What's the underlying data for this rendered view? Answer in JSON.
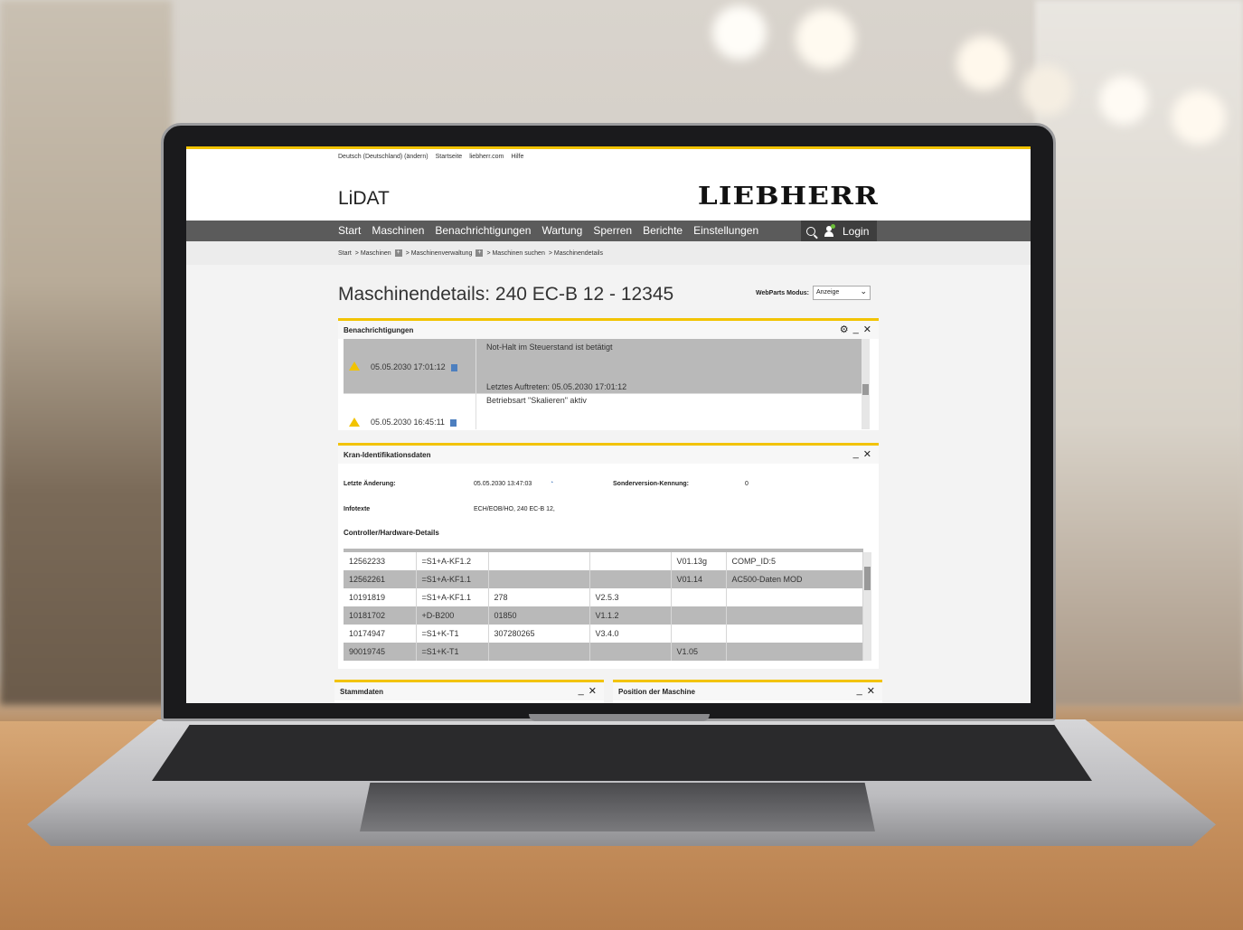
{
  "toplinks": [
    "Deutsch (Deutschland) (ändern)",
    "Startseite",
    "liebherr.com",
    "Hilfe"
  ],
  "app_title": "LiDAT",
  "logo_text": "LIEBHERR",
  "nav": [
    "Start",
    "Maschinen",
    "Benachrichtigungen",
    "Wartung",
    "Sperren",
    "Berichte",
    "Einstellungen"
  ],
  "login_label": "Login",
  "breadcrumb": [
    "Start",
    "> Maschinen",
    "> Maschinenverwaltung",
    "> Maschinen suchen",
    "> Maschinendetails"
  ],
  "page_title": "Maschinendetails: 240 EC-B 12 - 12345",
  "webparts": {
    "label": "WebParts Modus:",
    "value": "Anzeige"
  },
  "notifications": {
    "title": "Benachrichtigungen",
    "items": [
      {
        "date": "05.05.2030 17:01:12",
        "message": "Not-Halt im Steuerstand ist betätigt",
        "detail": "Letztes Auftreten: 05.05.2030 17:01:12"
      },
      {
        "date": "05.05.2030 16:45:11",
        "message": "Betriebsart \"Skalieren\" aktiv",
        "detail": ""
      }
    ]
  },
  "kran": {
    "title": "Kran-Identifikationsdaten",
    "letzte_label": "Letzte Änderung:",
    "letzte_value": "05.05.2030 13:47:03",
    "sonder_label": "Sonderversion-Kennung:",
    "sonder_value": "0",
    "infotexte_label": "Infotexte",
    "infotexte_value": "ECH/EOB/HO, 240 EC-B 12,",
    "controller_label": "Controller/Hardware-Details",
    "rows": [
      [
        "12562233",
        "=S1+A-KF1.2",
        "",
        "",
        "V01.13g",
        "COMP_ID:5"
      ],
      [
        "12562261",
        "=S1+A-KF1.1",
        "",
        "",
        "V01.14",
        "AC500-Daten MOD"
      ],
      [
        "10191819",
        "=S1+A-KF1.1",
        "278",
        "V2.5.3",
        "",
        ""
      ],
      [
        "10181702",
        "+D-B200",
        "01850",
        "V1.1.2",
        "",
        ""
      ],
      [
        "10174947",
        "=S1+K-T1",
        "307280265",
        "V3.4.0",
        "",
        ""
      ],
      [
        "90019745",
        "=S1+K-T1",
        "",
        "",
        "V1.05",
        ""
      ]
    ]
  },
  "stammdaten_title": "Stammdaten",
  "position_title": "Position der Maschine",
  "colors": {
    "accent": "#f2c300",
    "nav": "#5b5b5b",
    "row_grey": "#b9b9b9"
  }
}
